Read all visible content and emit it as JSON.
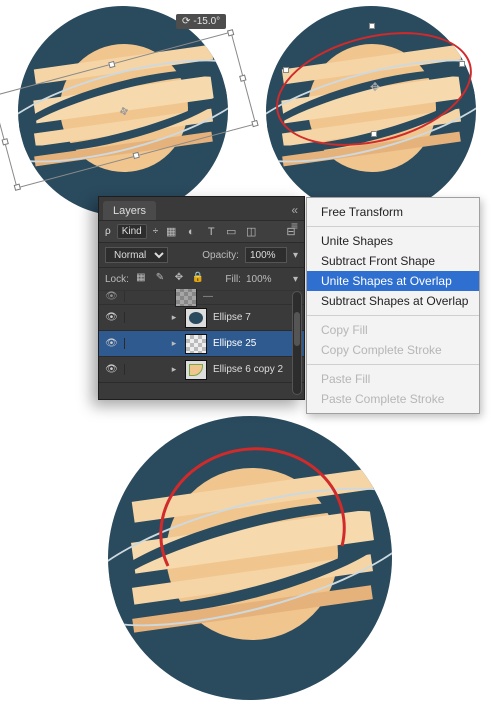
{
  "rotate_tooltip": "-15.0°",
  "context_menu": {
    "items": [
      {
        "label": "Free Transform",
        "state": "normal"
      },
      {
        "sep": true
      },
      {
        "label": "Unite Shapes",
        "state": "normal"
      },
      {
        "label": "Subtract Front Shape",
        "state": "normal"
      },
      {
        "label": "Unite Shapes at Overlap",
        "state": "highlight"
      },
      {
        "label": "Subtract Shapes at Overlap",
        "state": "normal"
      },
      {
        "sep": true
      },
      {
        "label": "Copy Fill",
        "state": "disabled"
      },
      {
        "label": "Copy Complete Stroke",
        "state": "disabled"
      },
      {
        "sep": true
      },
      {
        "label": "Paste Fill",
        "state": "disabled"
      },
      {
        "label": "Paste Complete Stroke",
        "state": "disabled"
      }
    ]
  },
  "layers_panel": {
    "tab": "Layers",
    "filter_kind": "Kind",
    "blend_mode": "Normal",
    "opacity_label": "Opacity:",
    "opacity_value": "100%",
    "lock_label": "Lock:",
    "fill_label": "Fill:",
    "fill_value": "100%",
    "rows": [
      {
        "name": "Ellipse 7",
        "selected": false
      },
      {
        "name": "Ellipse 25",
        "selected": true
      },
      {
        "name": "Ellipse 6 copy 2",
        "selected": false
      }
    ]
  }
}
